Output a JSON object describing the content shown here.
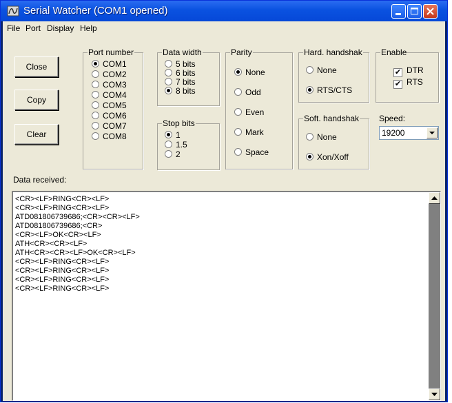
{
  "window": {
    "title": "Serial Watcher (COM1 opened)"
  },
  "menu": [
    "File",
    "Port",
    "Display",
    "Help"
  ],
  "buttons": {
    "close": "Close",
    "copy": "Copy",
    "clear": "Clear"
  },
  "port_number": {
    "label": "Port number",
    "options": [
      "COM1",
      "COM2",
      "COM3",
      "COM4",
      "COM5",
      "COM6",
      "COM7",
      "COM8"
    ],
    "selected": "COM1"
  },
  "data_width": {
    "label": "Data width",
    "options": [
      "5 bits",
      "6 bits",
      "7 bits",
      "8 bits"
    ],
    "selected": "8 bits"
  },
  "stop_bits": {
    "label": "Stop bits",
    "options": [
      "1",
      "1.5",
      "2"
    ],
    "selected": "1"
  },
  "parity": {
    "label": "Parity",
    "options": [
      "None",
      "Odd",
      "Even",
      "Mark",
      "Space"
    ],
    "selected": "None"
  },
  "hard_handshake": {
    "label": "Hard. handshak",
    "options": [
      "None",
      "RTS/CTS"
    ],
    "selected": "RTS/CTS"
  },
  "soft_handshake": {
    "label": "Soft. handshak",
    "options": [
      "None",
      "Xon/Xoff"
    ],
    "selected": "Xon/Xoff"
  },
  "enable": {
    "label": "Enable",
    "options": [
      "DTR",
      "RTS"
    ],
    "checked": [
      "DTR",
      "RTS"
    ]
  },
  "speed": {
    "label": "Speed:",
    "value": "19200"
  },
  "data_received": {
    "label": "Data received:",
    "lines": [
      "<CR><LF>RING<CR><LF>",
      "<CR><LF>RING<CR><LF>",
      "ATD081806739686;<CR><CR><LF>",
      "ATD081806739686;<CR>",
      "<CR><LF>OK<CR><LF>",
      "ATH<CR><CR><LF>",
      "ATH<CR><CR><LF>OK<CR><LF>",
      "<CR><LF>RING<CR><LF>",
      "<CR><LF>RING<CR><LF>",
      "<CR><LF>RING<CR><LF>",
      "<CR><LF>RING<CR><LF>"
    ]
  }
}
